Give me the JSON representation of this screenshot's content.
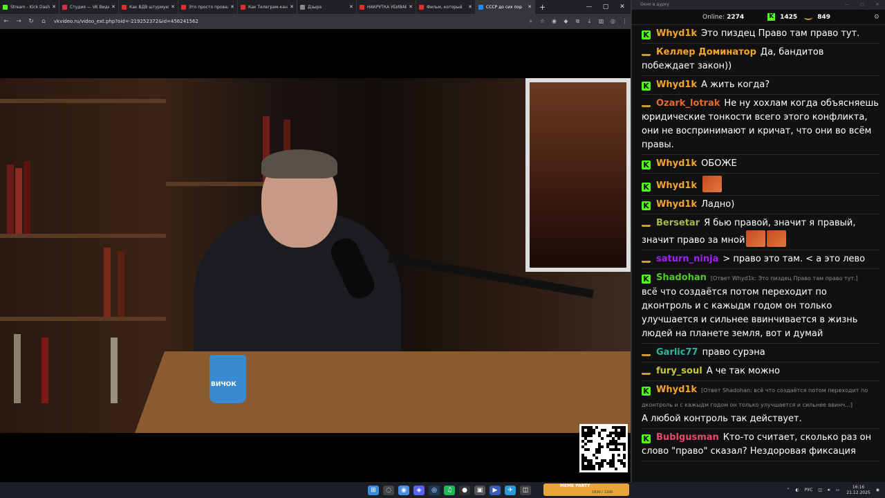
{
  "browser": {
    "tabs": [
      {
        "label": "Stream - Kick Dash",
        "color": "#53fc18",
        "active": false
      },
      {
        "label": "Студия — VK Видео",
        "color": "#e22b4a",
        "active": false
      },
      {
        "label": "Как ВДВ штурмуют",
        "color": "#e22b2b",
        "active": false
      },
      {
        "label": "Это просто провал",
        "color": "#e22b2b",
        "active": false
      },
      {
        "label": "Как Телеграм-кан",
        "color": "#e22b2b",
        "active": false
      },
      {
        "label": "Дзыра",
        "color": "#888888",
        "active": false
      },
      {
        "label": "НАКРУТКА УБИВАЕ",
        "color": "#e22b2b",
        "active": false
      },
      {
        "label": "Фильм, который",
        "color": "#e22b2b",
        "active": false
      },
      {
        "label": "СССР до сих пор",
        "color": "#2787f5",
        "active": true
      }
    ],
    "url": "vkvideo.ru/video_ext.php?oid=-219252372&id=456241562",
    "new_tab": "+",
    "window_controls": [
      "—",
      "▢",
      "✕"
    ]
  },
  "video": {
    "mug_text": "ВИЧОК"
  },
  "chat": {
    "window_title": "Окно в дурку",
    "online_label": "Online:",
    "online_count": "2274",
    "kick_count": "1425",
    "twitch_count": "849",
    "messages": [
      {
        "platform": "kick",
        "user": "Whyd1k",
        "color": "#f5a52a",
        "text": "Это пиздец Право там право тут."
      },
      {
        "platform": "twitch",
        "user": "Келлер Доминатор",
        "color": "#f5a52a",
        "text": "Да, бандитов побеждает закон))"
      },
      {
        "platform": "kick",
        "user": "Whyd1k",
        "color": "#f5a52a",
        "text": "А жить когда?"
      },
      {
        "platform": "twitch",
        "user": "Ozark_lotrak",
        "color": "#e86a2b",
        "text": "Не ну хохлам когда объясняешь юридические тонкости всего этого конфликта, они не воспринимают и кричат, что они во всём правы."
      },
      {
        "platform": "kick",
        "user": "Whyd1k",
        "color": "#f5a52a",
        "text": "ОБОЖЕ"
      },
      {
        "platform": "kick",
        "user": "Whyd1k",
        "color": "#f5a52a",
        "text": "",
        "emotes": 1
      },
      {
        "platform": "kick",
        "user": "Whyd1k",
        "color": "#f5a52a",
        "text": "Ладно)"
      },
      {
        "platform": "twitch",
        "user": "Bersetar",
        "color": "#a8b84a",
        "text": "Я бью правой, значит я правый, значит право за мной",
        "emotes": 2
      },
      {
        "platform": "twitch",
        "user": "saturn_ninja",
        "color": "#a020f0",
        "text": "> право это там. < а это лево"
      },
      {
        "platform": "kick",
        "user": "Shadohan",
        "color": "#53c82a",
        "reply": "[Ответ Whyd1k: Это пиздец Право там право тут.]",
        "text": "всё что создаётся потом переходит по дконтроль и с кажыдм годом он только улучшается и сильнее ввинчивается в жизнь людей на планете земля, вот и думай"
      },
      {
        "platform": "twitch",
        "user": "Garlic77",
        "color": "#2ab89a",
        "text": "право сурэна"
      },
      {
        "platform": "twitch",
        "user": "fury_soul",
        "color": "#c8c83a",
        "text": "А че так можно"
      },
      {
        "platform": "kick",
        "user": "Whyd1k",
        "color": "#f5a52a",
        "reply": "[Ответ Shadohan: всё что создаётся потом переходит по дконтроль и с кажыдм годом он только улучшается и сильнее ввинч...]",
        "text": "А любой контроль так действует."
      },
      {
        "platform": "kick",
        "user": "Bublgusman",
        "color": "#e84a6a",
        "text": "Кто-то считает, сколько раз он слово \"право\" сказал? Нездоровая фиксация"
      }
    ]
  },
  "taskbar": {
    "meme_label": "MEME PARTY",
    "meme_count": "1830 / 1100",
    "lang": "РУС",
    "time": "16:16",
    "date": "21.12.2025"
  }
}
